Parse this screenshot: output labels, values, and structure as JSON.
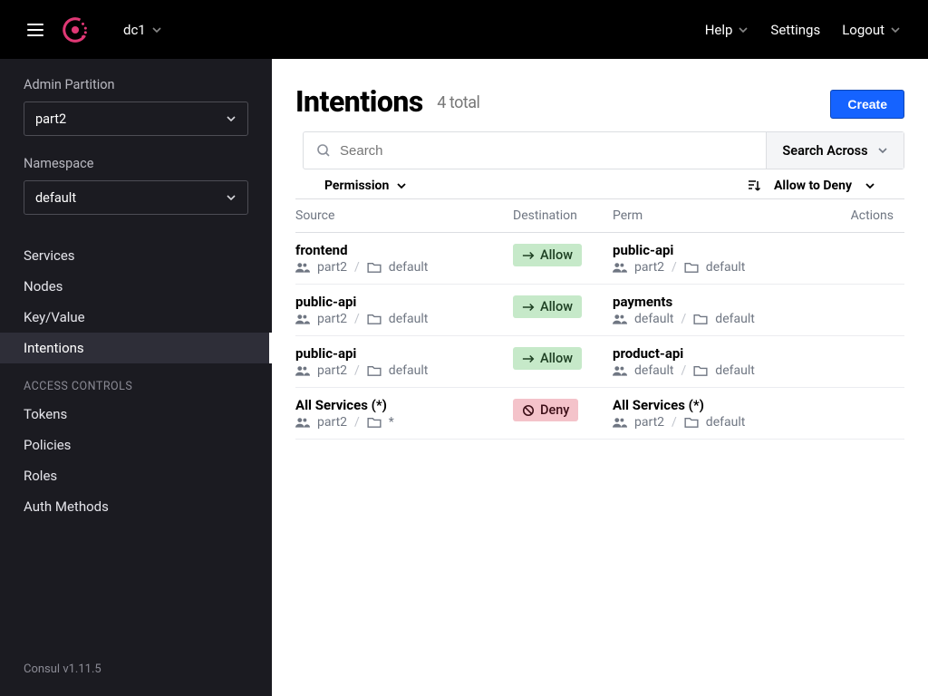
{
  "topbar": {
    "datacenter": "dc1",
    "help": "Help",
    "settings": "Settings",
    "logout": "Logout"
  },
  "sidebar": {
    "admin_partition_label": "Admin Partition",
    "admin_partition_value": "part2",
    "namespace_label": "Namespace",
    "namespace_value": "default",
    "nav": {
      "services": "Services",
      "nodes": "Nodes",
      "kv": "Key/Value",
      "intentions": "Intentions"
    },
    "access_heading": "ACCESS CONTROLS",
    "access": {
      "tokens": "Tokens",
      "policies": "Policies",
      "roles": "Roles",
      "auth": "Auth Methods"
    },
    "version": "Consul v1.11.5"
  },
  "page": {
    "title": "Intentions",
    "count": "4 total",
    "create": "Create",
    "search_placeholder": "Search",
    "search_across": "Search Across",
    "filter_permission": "Permission",
    "sort_label": "Allow to Deny",
    "columns": {
      "source": "Source",
      "destination": "Destination",
      "perm": "Perm",
      "actions": "Actions"
    }
  },
  "rows": [
    {
      "src": "frontend",
      "src_part": "part2",
      "src_ns": "default",
      "perm": "Allow",
      "dst": "public-api",
      "dst_part": "part2",
      "dst_ns": "default"
    },
    {
      "src": "public-api",
      "src_part": "part2",
      "src_ns": "default",
      "perm": "Allow",
      "dst": "payments",
      "dst_part": "default",
      "dst_ns": "default"
    },
    {
      "src": "public-api",
      "src_part": "part2",
      "src_ns": "default",
      "perm": "Allow",
      "dst": "product-api",
      "dst_part": "default",
      "dst_ns": "default"
    },
    {
      "src": "All Services (*)",
      "src_part": "part2",
      "src_ns": "*",
      "perm": "Deny",
      "dst": "All Services (*)",
      "dst_part": "part2",
      "dst_ns": "default"
    }
  ]
}
